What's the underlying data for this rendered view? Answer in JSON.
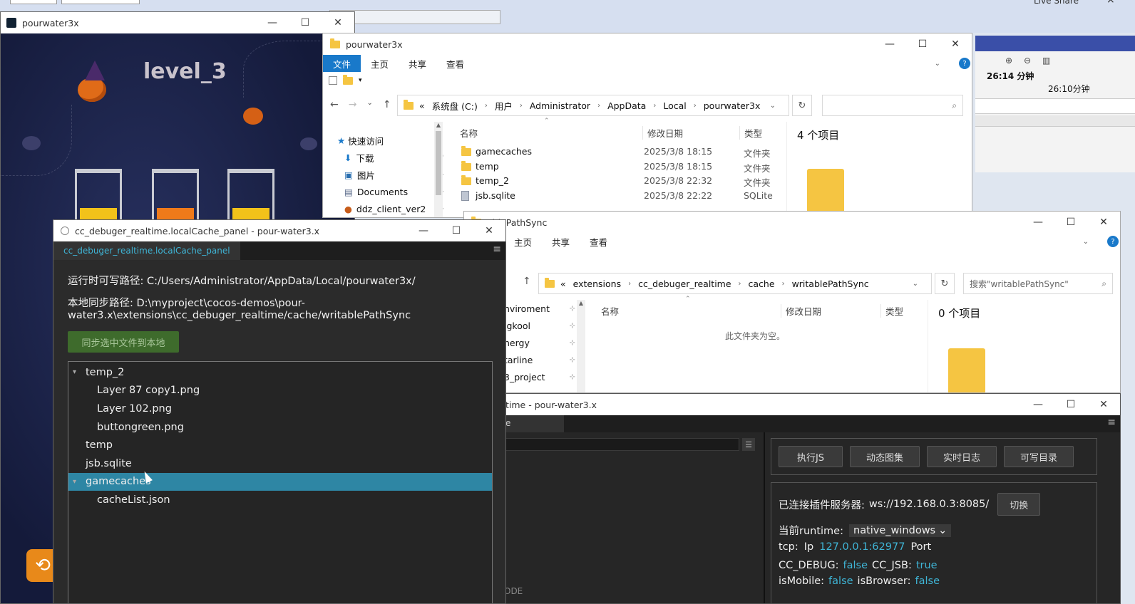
{
  "top_strip": {
    "live_share": "Live Share",
    "close_glyph": "×"
  },
  "game_window": {
    "title": "pourwater3x",
    "level": "level_3",
    "colors": {
      "sky": "#141a3a",
      "liquid_yellow": "#f2c21a",
      "liquid_orange": "#ef7a1a",
      "pumpkin": "#e06b18"
    },
    "tubes": [
      {
        "liquid": "yellow"
      },
      {
        "liquid": "orange"
      },
      {
        "liquid": "yellow"
      }
    ]
  },
  "explorer1": {
    "title": "pourwater3x",
    "ribbon": [
      "文件",
      "主页",
      "共享",
      "查看"
    ],
    "address": [
      "«",
      "系统盘 (C:)",
      "用户",
      "Administrator",
      "AppData",
      "Local",
      "pourwater3x"
    ],
    "nav": [
      {
        "label": "快速访问",
        "icon": "star-icon"
      },
      {
        "label": "下载",
        "icon": "download-icon"
      },
      {
        "label": "图片",
        "icon": "picture-icon"
      },
      {
        "label": "Documents",
        "icon": "document-icon"
      },
      {
        "label": "ddz_client_ver2",
        "icon": "app-icon"
      }
    ],
    "columns": {
      "name": "名称",
      "date": "修改日期",
      "type": "类型"
    },
    "files": [
      {
        "name": "gamecaches",
        "date": "2025/3/8 18:15",
        "type": "文件夹",
        "icon": "folder-icon"
      },
      {
        "name": "temp",
        "date": "2025/3/8 18:15",
        "type": "文件夹",
        "icon": "folder-icon"
      },
      {
        "name": "temp_2",
        "date": "2025/3/8 22:32",
        "type": "文件夹",
        "icon": "folder-icon"
      },
      {
        "name": "jsb.sqlite",
        "date": "2025/3/8 22:22",
        "type": "SQLite",
        "icon": "file-icon"
      }
    ],
    "count": "4 个项目"
  },
  "vs_bg": {
    "time_left": "26:14 分钟",
    "time_right": "26:10分钟"
  },
  "explorer2": {
    "title": "ablePathSync",
    "ribbon": [
      "主页",
      "共享",
      "查看"
    ],
    "address": [
      "«",
      "extensions",
      "cc_debuger_realtime",
      "cache",
      "writablePathSync"
    ],
    "search_placeholder": "搜索\"writablePathSync\"",
    "nav": [
      "nviroment",
      "igkool",
      "nergy",
      "tarline",
      "3_project"
    ],
    "columns": {
      "name": "名称",
      "date": "修改日期",
      "type": "类型"
    },
    "empty": "此文件夹为空。",
    "count": "0 个项目"
  },
  "debugger_panel": {
    "title": "cc_debuger_realtime.localCache_panel - pour-water3.x",
    "tab": "cc_debuger_realtime.localCache_panel",
    "runtime_path": "运行时可写路径: C:/Users/Administrator/AppData/Local/pourwater3x/",
    "local_path_line1": "本地同步路径: D:\\myproject\\cocos-demos\\pour-",
    "local_path_line2": "water3.x\\extensions\\cc_debuger_realtime/cache/writablePathSync",
    "sync_button": "同步选中文件到本地",
    "tree": [
      {
        "label": "temp_2",
        "level": 0,
        "arrow": "▾",
        "selected": false
      },
      {
        "label": "Layer 87 copy1.png",
        "level": 1,
        "arrow": "",
        "selected": false
      },
      {
        "label": "Layer 102.png",
        "level": 1,
        "arrow": "",
        "selected": false
      },
      {
        "label": "buttongreen.png",
        "level": 1,
        "arrow": "",
        "selected": false
      },
      {
        "label": "temp",
        "level": 0,
        "arrow": "",
        "selected": false
      },
      {
        "label": "jsb.sqlite",
        "level": 0,
        "arrow": "",
        "selected": false
      },
      {
        "label": "gamecaches",
        "level": 0,
        "arrow": "▾",
        "selected": true
      },
      {
        "label": "cacheList.json",
        "level": 1,
        "arrow": "",
        "selected": false
      }
    ]
  },
  "realtime": {
    "title": "time - pour-water3.x",
    "tab_fragment": "e",
    "bottom_fragment": "ODE",
    "buttons": [
      "执行JS",
      "动态图集",
      "实时日志",
      "可写目录"
    ],
    "server_label": "已连接插件服务器:",
    "server_url": "ws://192.168.0.3:8085/",
    "switch_button": "切换",
    "runtime_label": "当前runtime:",
    "runtime_value": "native_windows",
    "tcp_label": "tcp:",
    "ip_label": "Ip",
    "ip_value": "127.0.0.1:62977",
    "port_label": "Port",
    "flags": [
      {
        "label": "CC_DEBUG:",
        "value": "false"
      },
      {
        "label": "CC_JSB:",
        "value": "true"
      },
      {
        "label": "isMobile:",
        "value": "false"
      },
      {
        "label": "isBrowser:",
        "value": "false"
      }
    ]
  }
}
